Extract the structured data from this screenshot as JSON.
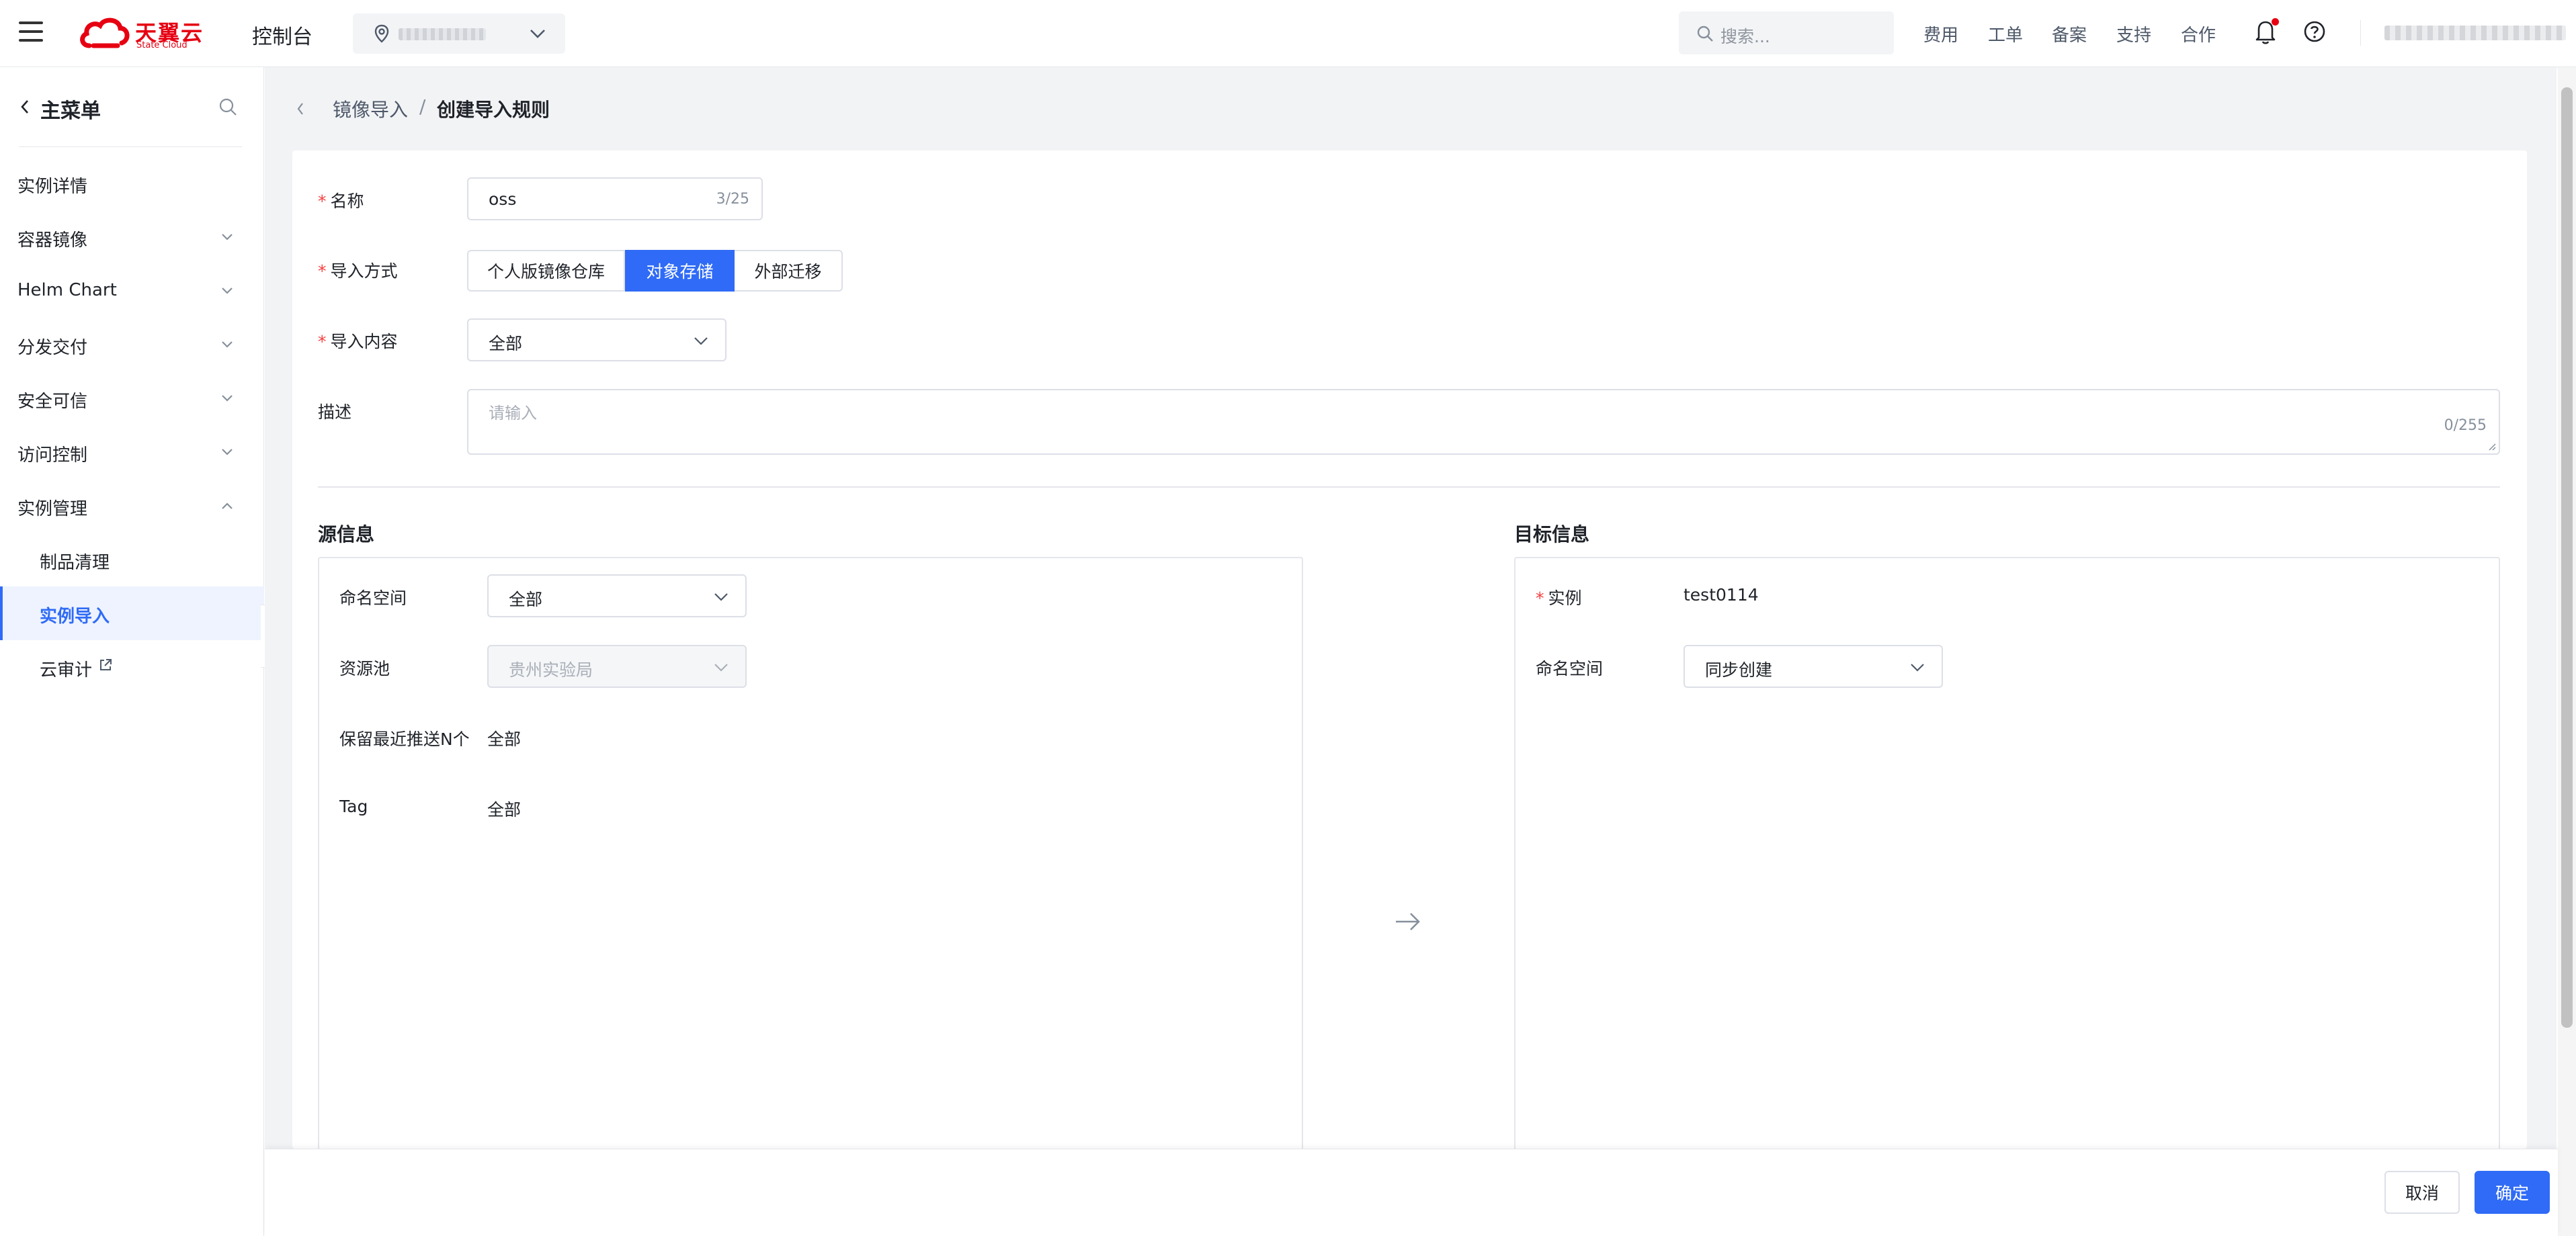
{
  "header": {
    "logo_text": "天翼云",
    "logo_sub": "State Cloud",
    "console_title": "控制台",
    "search_placeholder": "搜索...",
    "links": [
      "费用",
      "工单",
      "备案",
      "支持",
      "合作"
    ]
  },
  "sidebar": {
    "title": "主菜单",
    "items": [
      {
        "label": "实例详情"
      },
      {
        "label": "容器镜像"
      },
      {
        "label": "Helm Chart"
      },
      {
        "label": "分发交付"
      },
      {
        "label": "安全可信"
      },
      {
        "label": "访问控制"
      },
      {
        "label": "实例管理"
      },
      {
        "label": "制品清理"
      },
      {
        "label": "实例导入"
      },
      {
        "label": "云审计"
      }
    ]
  },
  "breadcrumb": {
    "parent": "镜像导入",
    "separator": "/",
    "current": "创建导入规则"
  },
  "form": {
    "name_label": "名称",
    "name_value": "oss",
    "name_count": "3/25",
    "method_label": "导入方式",
    "methods": [
      "个人版镜像仓库",
      "对象存储",
      "外部迁移"
    ],
    "method_selected": "对象存储",
    "content_label": "导入内容",
    "content_value": "全部",
    "desc_label": "描述",
    "desc_placeholder": "请输入",
    "desc_count": "0/255"
  },
  "source": {
    "title": "源信息",
    "namespace_label": "命名空间",
    "namespace_value": "全部",
    "pool_label": "资源池",
    "pool_value": "贵州实验局",
    "keep_label": "保留最近推送N个",
    "keep_value": "全部",
    "tag_label": "Tag",
    "tag_value": "全部"
  },
  "target": {
    "title": "目标信息",
    "instance_label": "实例",
    "instance_value": "test0114",
    "namespace_label": "命名空间",
    "namespace_value": "同步创建"
  },
  "footer": {
    "cancel_label": "取消",
    "confirm_label": "确定"
  },
  "colors": {
    "primary": "#2f6bf6",
    "brand_red": "#e60012",
    "required": "#f53f3f"
  }
}
